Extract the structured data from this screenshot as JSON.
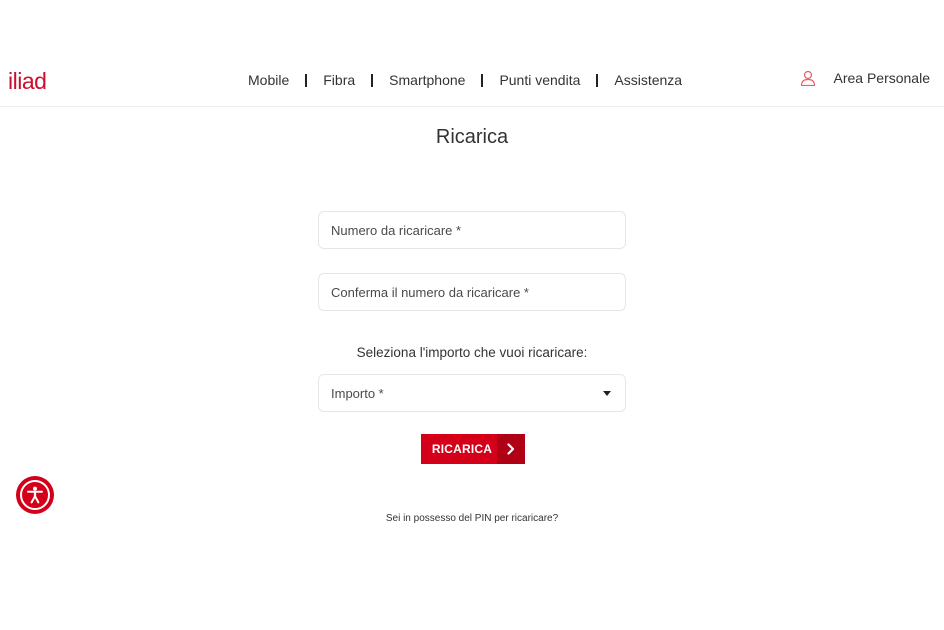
{
  "brand": {
    "logo_text": "iliad",
    "accent_color": "#d4001a"
  },
  "nav": {
    "items": [
      {
        "label": "Mobile"
      },
      {
        "label": "Fibra"
      },
      {
        "label": "Smartphone"
      },
      {
        "label": "Punti vendita"
      },
      {
        "label": "Assistenza"
      }
    ],
    "account_label": "Area Personale",
    "account_icon": "user-icon"
  },
  "main": {
    "title": "Ricarica",
    "number_field": {
      "placeholder": "Numero da ricaricare *",
      "value": ""
    },
    "confirm_field": {
      "placeholder": "Conferma il numero da ricaricare *",
      "value": ""
    },
    "amount_label": "Seleziona l'importo che vuoi ricaricare:",
    "amount_select": {
      "selected": "Importo *"
    },
    "submit_label": "RICARICA",
    "pin_link": "Sei in possesso del PIN per ricaricare?"
  },
  "accessibility": {
    "icon": "accessibility-icon"
  }
}
